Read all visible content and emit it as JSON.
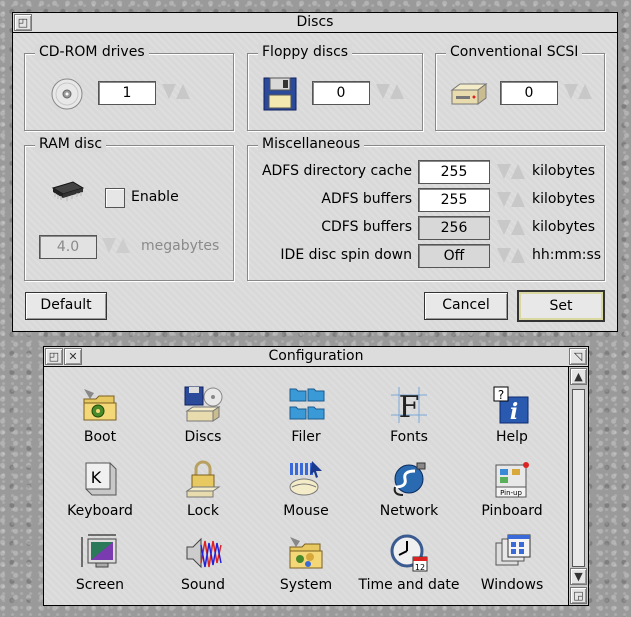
{
  "discs_window": {
    "title": "Discs",
    "cdrom": {
      "label": "CD-ROM drives",
      "value": "1"
    },
    "floppy": {
      "label": "Floppy discs",
      "value": "0"
    },
    "scsi": {
      "label": "Conventional SCSI",
      "value": "0"
    },
    "ram": {
      "label": "RAM disc",
      "enable_label": "Enable",
      "value": "4.0",
      "unit": "megabytes"
    },
    "misc": {
      "label": "Miscellaneous",
      "rows": [
        {
          "label": "ADFS directory cache",
          "value": "255",
          "unit": "kilobytes"
        },
        {
          "label": "ADFS buffers",
          "value": "255",
          "unit": "kilobytes"
        },
        {
          "label": "CDFS buffers",
          "value": "256",
          "unit": "kilobytes"
        },
        {
          "label": "IDE disc spin down",
          "value": "Off",
          "unit": "hh:mm:ss"
        }
      ]
    },
    "buttons": {
      "default": "Default",
      "cancel": "Cancel",
      "set": "Set"
    }
  },
  "config_window": {
    "title": "Configuration",
    "items": [
      {
        "label": "Boot",
        "icon": "boot-icon"
      },
      {
        "label": "Discs",
        "icon": "discs-icon"
      },
      {
        "label": "Filer",
        "icon": "filer-icon"
      },
      {
        "label": "Fonts",
        "icon": "fonts-icon"
      },
      {
        "label": "Help",
        "icon": "help-icon"
      },
      {
        "label": "Keyboard",
        "icon": "keyboard-icon"
      },
      {
        "label": "Lock",
        "icon": "lock-icon"
      },
      {
        "label": "Mouse",
        "icon": "mouse-icon"
      },
      {
        "label": "Network",
        "icon": "network-icon"
      },
      {
        "label": "Pinboard",
        "icon": "pinboard-icon"
      },
      {
        "label": "Screen",
        "icon": "screen-icon"
      },
      {
        "label": "Sound",
        "icon": "sound-icon"
      },
      {
        "label": "System",
        "icon": "system-icon"
      },
      {
        "label": "Time and date",
        "icon": "clock-icon"
      },
      {
        "label": "Windows",
        "icon": "windows-icon"
      }
    ],
    "pinboard_tag": "Pin-up",
    "keyboard_key": "K",
    "fonts_glyph": "F",
    "help_glyph": "i",
    "help_tag": "?",
    "calendar_day": "12"
  }
}
